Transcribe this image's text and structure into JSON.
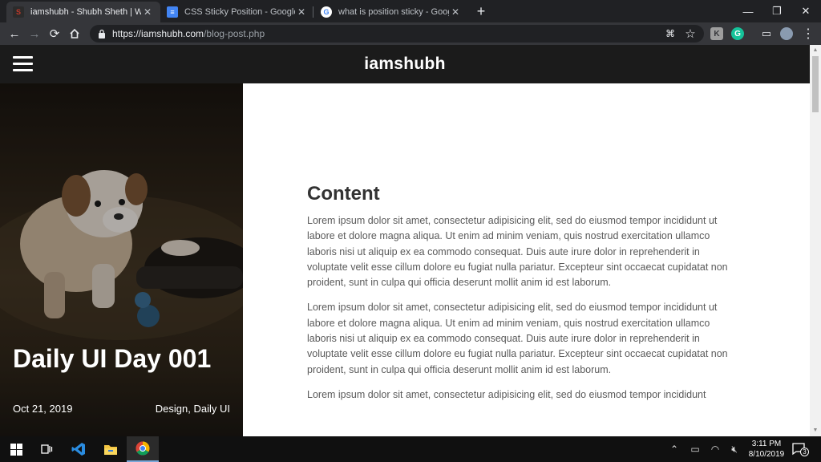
{
  "browser": {
    "tabs": [
      {
        "title": "iamshubh - Shubh Sheth | Web D",
        "favicon": "s-logo-icon",
        "color": "#c0392b"
      },
      {
        "title": "CSS Sticky Position - Google Doc",
        "favicon": "google-docs-icon",
        "color": "#4285f4"
      },
      {
        "title": "what is position sticky - Google S",
        "favicon": "google-icon",
        "color": "#ffffff"
      }
    ],
    "new_tab": "+",
    "url_host": "https://iamshubh.com",
    "url_path": "/blog-post.php"
  },
  "site": {
    "brand": "iamshubh",
    "hero": {
      "title": "Daily UI Day 001",
      "date": "Oct 21, 2019",
      "tags": "Design, Daily UI"
    },
    "content": {
      "heading": "Content",
      "paragraphs": [
        "Lorem ipsum dolor sit amet, consectetur adipisicing elit, sed do eiusmod tempor incididunt ut labore et dolore magna aliqua. Ut enim ad minim veniam, quis nostrud exercitation ullamco laboris nisi ut aliquip ex ea commodo consequat. Duis aute irure dolor in reprehenderit in voluptate velit esse cillum dolore eu fugiat nulla pariatur. Excepteur sint occaecat cupidatat non proident, sunt in culpa qui officia deserunt mollit anim id est laborum.",
        "Lorem ipsum dolor sit amet, consectetur adipisicing elit, sed do eiusmod tempor incididunt ut labore et dolore magna aliqua. Ut enim ad minim veniam, quis nostrud exercitation ullamco laboris nisi ut aliquip ex ea commodo consequat. Duis aute irure dolor in reprehenderit in voluptate velit esse cillum dolore eu fugiat nulla pariatur. Excepteur sint occaecat cupidatat non proident, sunt in culpa qui officia deserunt mollit anim id est laborum.",
        "Lorem ipsum dolor sit amet, consectetur adipisicing elit, sed do eiusmod tempor incididunt"
      ]
    }
  },
  "taskbar": {
    "time": "3:11 PM",
    "date": "8/10/2019",
    "notifications": "3"
  }
}
